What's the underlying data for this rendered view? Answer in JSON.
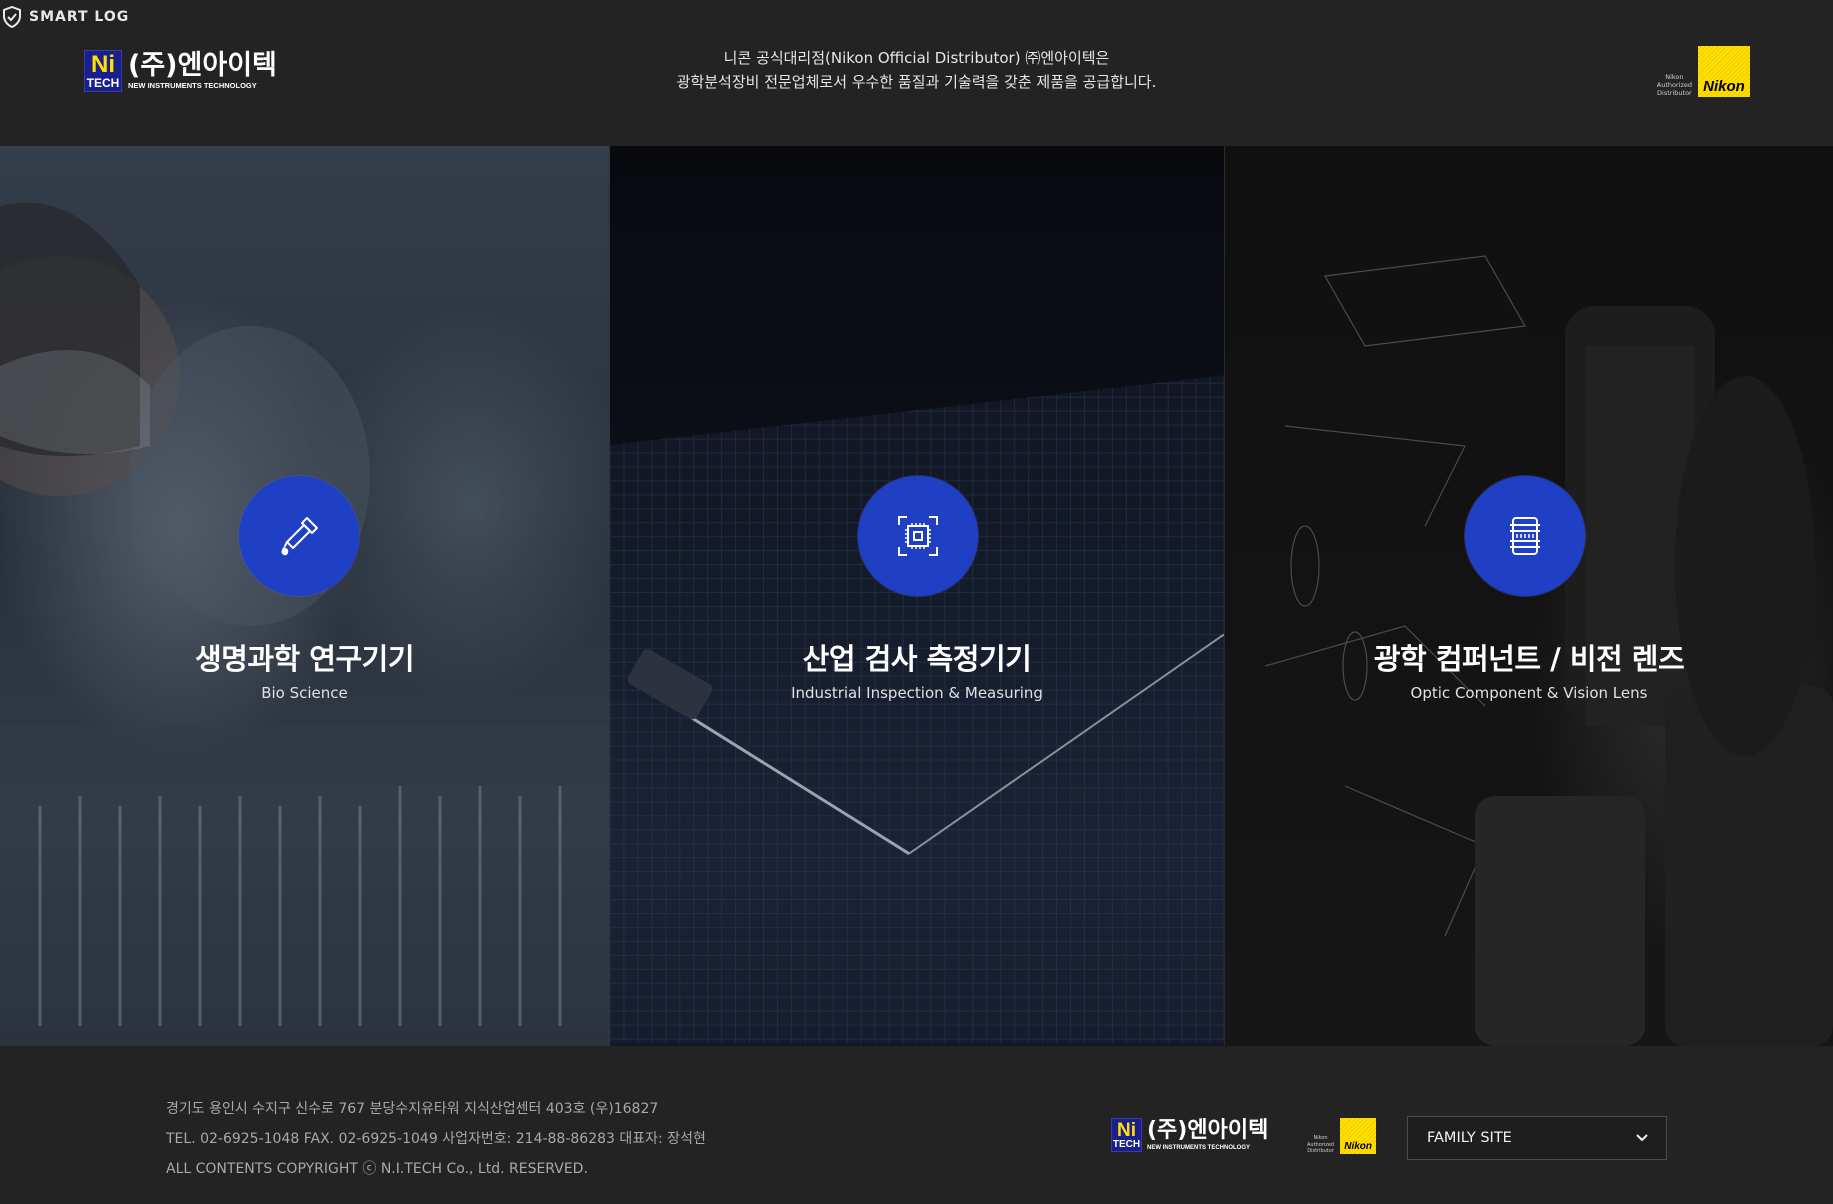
{
  "header": {
    "smartlog_label": "SMART LOG",
    "logo": {
      "ni_top": "Ni",
      "ni_bottom": "TECH",
      "ko": "(주)엔아이텍",
      "en": "NEW INSTRUMENTS TECHNOLOGY"
    },
    "tagline_line1": "니콘 공식대리점(Nikon Official Distributor) ㈜엔아이텍은",
    "tagline_line2": "광학분석장비 전문업체로서 우수한 품질과 기술력을 갖춘 제품을 공급합니다.",
    "nikon_badge": {
      "auth_line1": "Nikon",
      "auth_line2": "Authorized",
      "auth_line3": "Distributor",
      "word": "Nikon"
    }
  },
  "panels": [
    {
      "title": "생명과학 연구기기",
      "subtitle": "Bio Science",
      "icon": "dropper-icon"
    },
    {
      "title": "산업 검사 측정기기",
      "subtitle": "Industrial Inspection & Measuring",
      "icon": "chip-icon"
    },
    {
      "title": "광학 컴퍼넌트 / 비전 렌즈",
      "subtitle": "Optic Component & Vision Lens",
      "icon": "lens-icon"
    }
  ],
  "footer": {
    "address": "경기도 용인시 수지구 신수로 767 분당수지유타워 지식산업센터 403호 (우)16827",
    "contact": "TEL. 02-6925-1048  FAX. 02-6925-1049   사업자번호: 214-88-86283  대표자: 장석현",
    "copyright": "ALL CONTENTS COPYRIGHT ⓒ N.I.TECH Co., Ltd. RESERVED.",
    "family_site_label": "FAMILY SITE"
  },
  "colors": {
    "accent_blue": "#1f3fc4",
    "nikon_yellow": "#ffe100",
    "ni_navy": "#1a1f8e",
    "background": "#232323"
  }
}
